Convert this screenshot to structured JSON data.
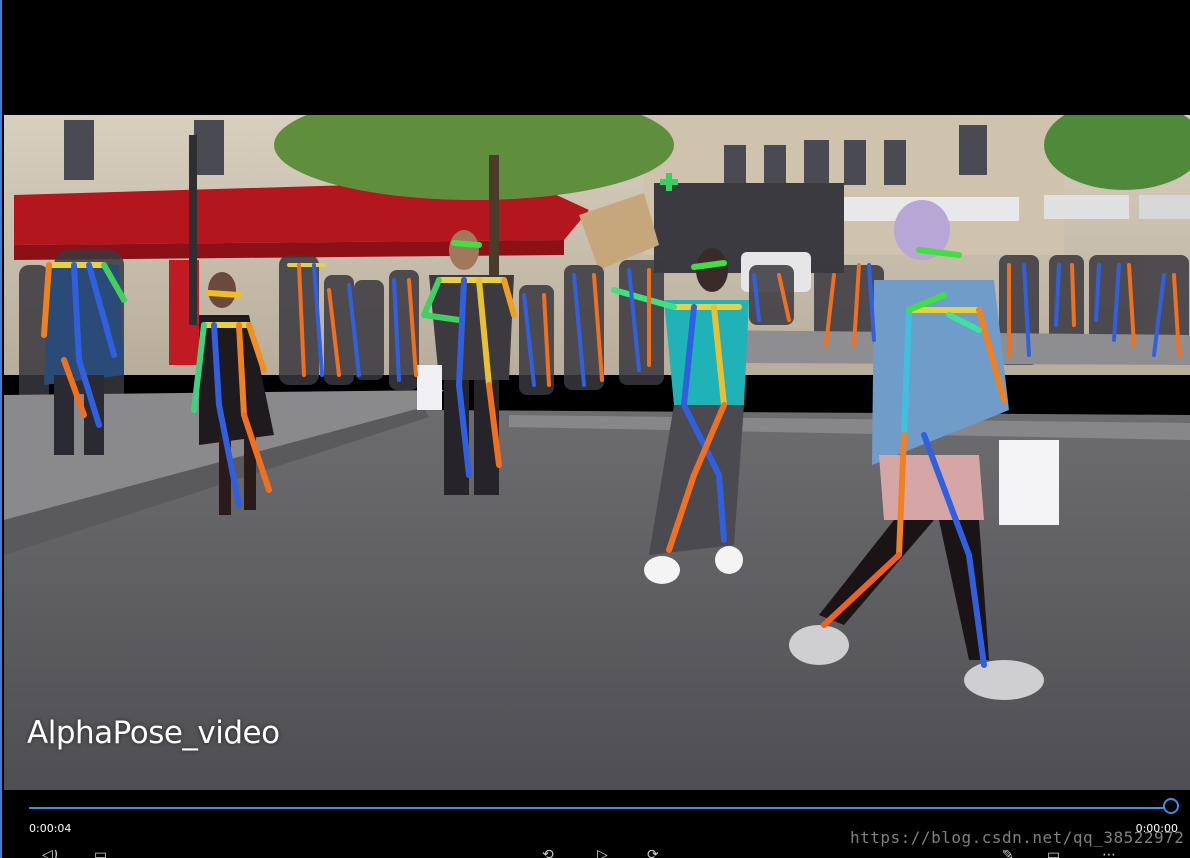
{
  "player": {
    "video_title": "AlphaPose_video",
    "elapsed_time": "0:00:04",
    "remaining_time": "0:00:00",
    "progress_fraction": 1.0,
    "accent_color": "#3b8fe4"
  },
  "watermark": {
    "text": "https://blog.csdn.net/qq_38522972"
  },
  "controls": {
    "icons": [
      "volume-icon",
      "subtitles-icon",
      "rewind-icon",
      "play-icon",
      "forward-icon",
      "edit-icon",
      "fullscreen-icon",
      "more-icon"
    ]
  },
  "scene": {
    "shop_sign": "",
    "skeleton_colors": {
      "limb_left": "#f07020",
      "limb_right": "#3060e0",
      "torso": "#e8c030",
      "head": "#40e040"
    }
  }
}
